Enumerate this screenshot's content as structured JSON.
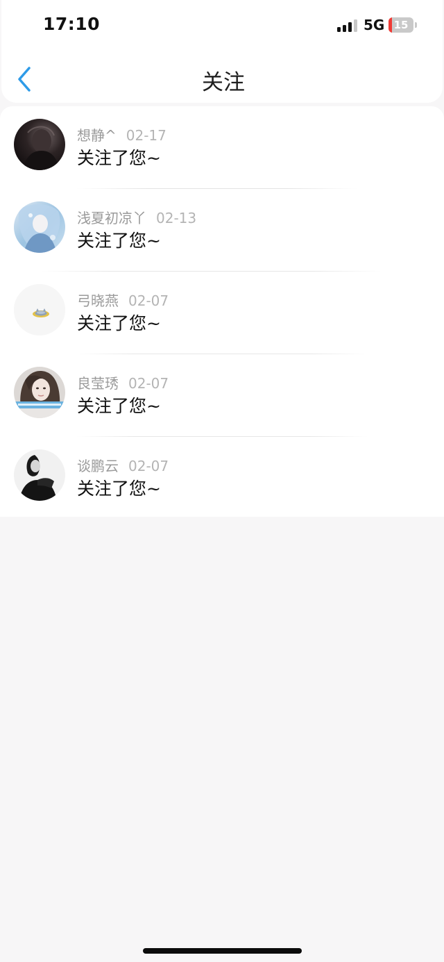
{
  "status_bar": {
    "time": "17:10",
    "network": "5G",
    "battery": "15",
    "battery_level": 0.15,
    "signal_bars_active": 3,
    "signal_bars_total": 4
  },
  "header": {
    "title": "关注",
    "back_icon": "chevron-left-icon",
    "accent_color": "#2e9be8"
  },
  "notifications": [
    {
      "name": "想静^",
      "date": "02-17",
      "message": "关注了您~",
      "avatar_icon": "user-avatar-dark-photo"
    },
    {
      "name": "浅夏初凉丫",
      "date": "02-13",
      "message": "关注了您~",
      "avatar_icon": "user-avatar-anime-blue"
    },
    {
      "name": "弓晓燕",
      "date": "02-07",
      "message": "关注了您~",
      "avatar_icon": "user-avatar-cat-cartoon"
    },
    {
      "name": "良莹琇",
      "date": "02-07",
      "message": "关注了您~",
      "avatar_icon": "user-avatar-girl-portrait"
    },
    {
      "name": "谈鹏云",
      "date": "02-07",
      "message": "关注了您~",
      "avatar_icon": "user-avatar-monochrome-photo"
    }
  ]
}
